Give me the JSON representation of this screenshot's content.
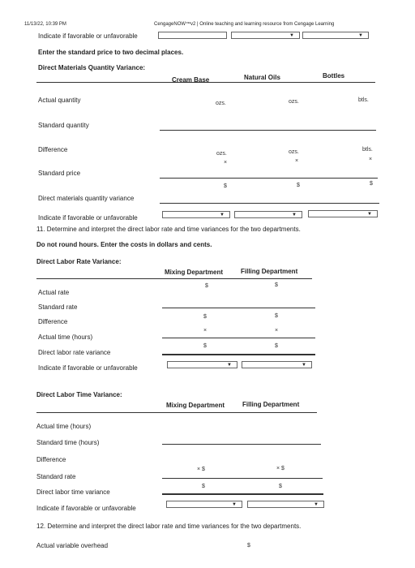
{
  "header": {
    "datetime": "11/13/22, 10:39 PM",
    "site": "CengageNOW™v2 | Online teaching and learning resource from Cengage Learning"
  },
  "section_a": {
    "fav_label": "Indicate if favorable or unfavorable",
    "instruction": "Enter the standard price to two decimal places.",
    "title": "Direct Materials Quantity Variance:",
    "col_cream": "Cream Base",
    "col_oils": "Natural Oils",
    "col_bottles": "Bottles",
    "rows": {
      "actual_quantity": "Actual quantity",
      "standard_quantity": "Standard quantity",
      "difference": "Difference",
      "standard_price": "Standard price",
      "variance": "Direct materials quantity variance",
      "fav": "Indicate if favorable or unfavorable"
    },
    "unit_ozs": "ozs.",
    "unit_btls": "btls.",
    "times": "×",
    "dollar": "$"
  },
  "q11": {
    "text": "11.  Determine and interpret the direct labor rate and time variances for the two departments.",
    "bold": "Do not round hours. Enter the costs in dollars and cents."
  },
  "rate": {
    "title": "Direct Labor Rate Variance:",
    "col_mix": "Mixing Department",
    "col_fill": "Filling Department",
    "rows": {
      "actual_rate": "Actual rate",
      "standard_rate": "Standard rate",
      "difference": "Difference",
      "actual_time": "Actual time (hours)",
      "variance": "Direct labor rate variance",
      "fav": "Indicate if favorable or unfavorable"
    }
  },
  "time": {
    "title": "Direct Labor Time Variance:",
    "col_mix": "Mixing Department",
    "col_fill": "Filling Department",
    "rows": {
      "actual_time": "Actual time (hours)",
      "standard_time": "Standard time (hours)",
      "difference": "Difference",
      "standard_rate": "Standard rate",
      "variance": "Direct labor time variance",
      "fav": "Indicate if favorable or unfavorable"
    },
    "times_dollar": "× $"
  },
  "q12": {
    "text": "12.  Determine and interpret the direct labor rate and time variances for the two departments."
  },
  "overhead": {
    "label": "Actual variable overhead"
  }
}
